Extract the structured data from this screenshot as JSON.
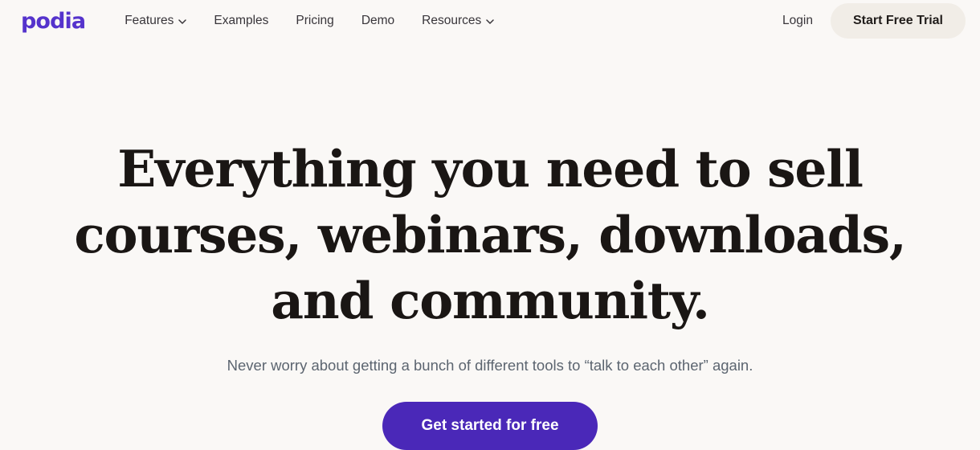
{
  "colors": {
    "page_background": "#FAF8F6",
    "brand_purple": "#5533CC",
    "cta_purple": "#4A28B8",
    "trial_button_background": "#F1EDE7",
    "heading_text": "#1A1614",
    "nav_text": "#38353A",
    "subtext": "#5C6570"
  },
  "header": {
    "logo_text": "podia",
    "logo_icon": "podia-wordmark",
    "nav_items": [
      {
        "label": "Features",
        "has_dropdown": true,
        "icon": "chevron-down-icon"
      },
      {
        "label": "Examples",
        "has_dropdown": false,
        "icon": ""
      },
      {
        "label": "Pricing",
        "has_dropdown": false,
        "icon": ""
      },
      {
        "label": "Demo",
        "has_dropdown": false,
        "icon": ""
      },
      {
        "label": "Resources",
        "has_dropdown": true,
        "icon": "chevron-down-icon"
      }
    ],
    "login_label": "Login",
    "trial_label": "Start Free Trial"
  },
  "hero": {
    "title": "Everything you need to sell courses, webinars, downloads, and community.",
    "subtitle": "Never worry about getting a bunch of different tools to “talk to each other” again.",
    "cta_label": "Get started for free"
  }
}
